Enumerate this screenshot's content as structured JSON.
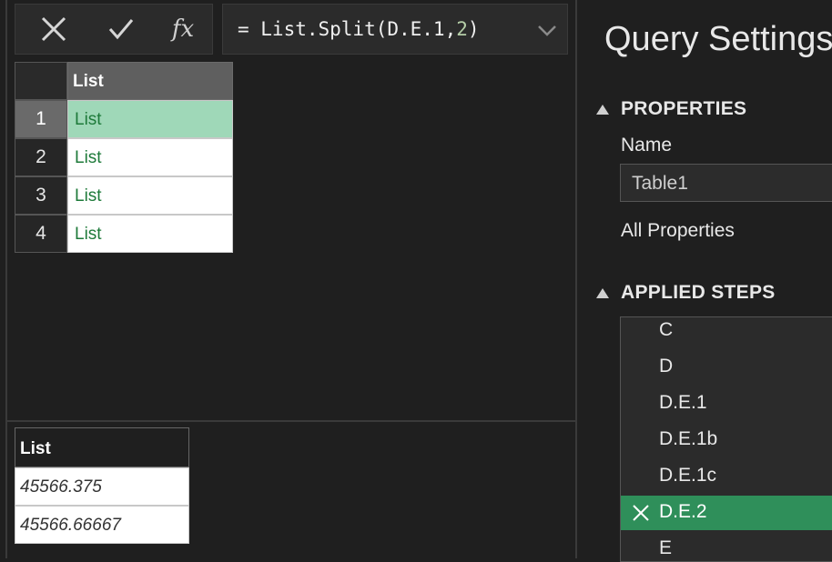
{
  "formula_bar": {
    "formula_prefix": "= List.Split(D.E.1,",
    "formula_number": "2",
    "formula_suffix": ")",
    "fx_label": "fx"
  },
  "grid": {
    "column_header": "List",
    "rows": [
      {
        "num": "1",
        "value": "List"
      },
      {
        "num": "2",
        "value": "List"
      },
      {
        "num": "3",
        "value": "List"
      },
      {
        "num": "4",
        "value": "List"
      }
    ]
  },
  "preview": {
    "header": "List",
    "values": [
      "45566.375",
      "45566.66667"
    ]
  },
  "query_settings": {
    "title": "Query Settings",
    "properties_header": "PROPERTIES",
    "name_label": "Name",
    "name_value": "Table1",
    "all_properties": "All Properties",
    "applied_steps_header": "APPLIED STEPS",
    "steps": [
      "C",
      "D",
      "D.E.1",
      "D.E.1b",
      "D.E.1c",
      "D.E.2",
      "E"
    ]
  },
  "colors": {
    "background": "#1f1f1f",
    "accent_green": "#2f8f5a",
    "selected_cell": "#9fd8b8",
    "list_text": "#1e7a3a"
  }
}
